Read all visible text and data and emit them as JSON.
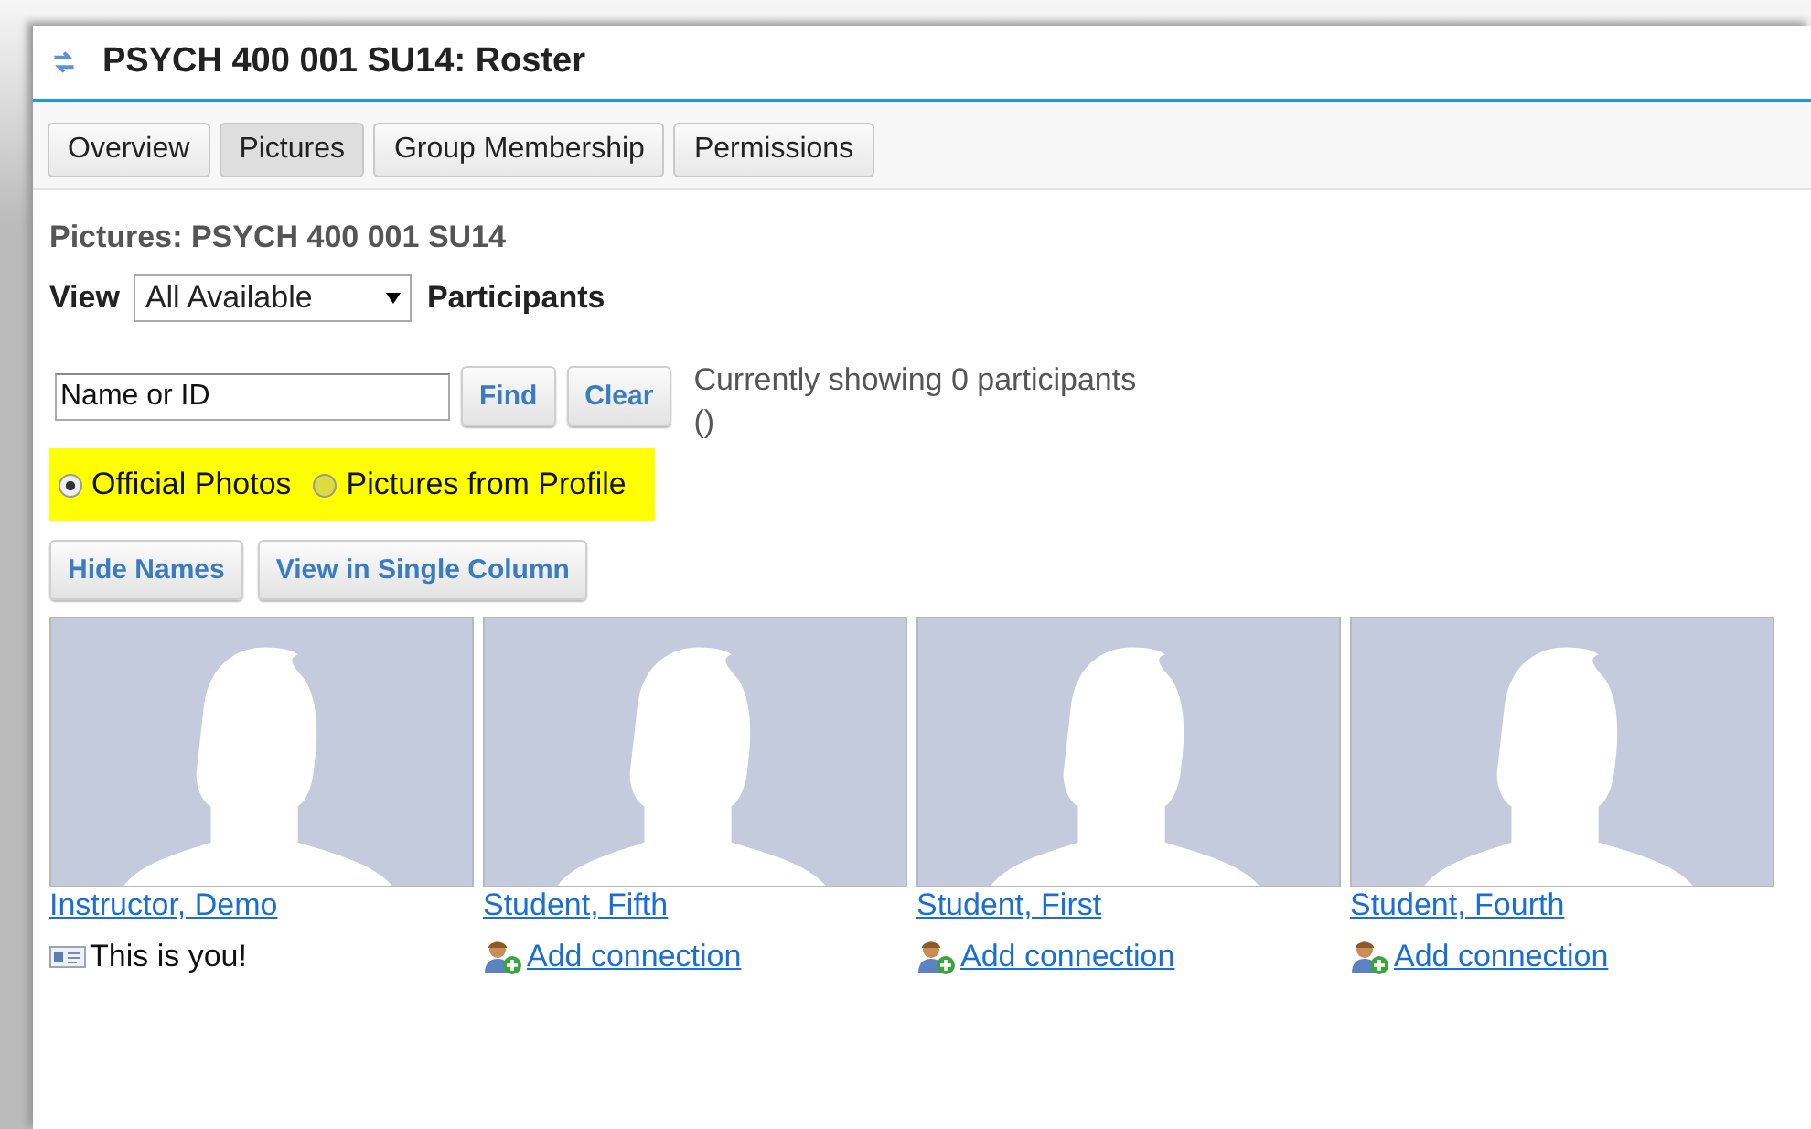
{
  "title": "PSYCH 400 001 SU14: Roster",
  "tabs": [
    {
      "label": "Overview",
      "selected": false
    },
    {
      "label": "Pictures",
      "selected": true
    },
    {
      "label": "Group Membership",
      "selected": false
    },
    {
      "label": "Permissions",
      "selected": false
    }
  ],
  "heading": "Pictures: PSYCH 400 001 SU14",
  "view": {
    "label": "View",
    "value": "All Available",
    "suffix": "Participants"
  },
  "search": {
    "value": "Name or ID",
    "buttons": [
      "Find",
      "Clear"
    ],
    "status": "Currently showing 0 participants",
    "status_extra": "()"
  },
  "photo_source": [
    {
      "label": "Official Photos",
      "selected": true
    },
    {
      "label": "Pictures from Profile",
      "selected": false
    }
  ],
  "actions": [
    "Hide Names",
    "View in Single Column"
  ],
  "participants": [
    {
      "name": "Instructor, Demo",
      "kind": "self",
      "note": "This is you!"
    },
    {
      "name": "Student, Fifth",
      "kind": "other",
      "note": "Add connection"
    },
    {
      "name": "Student, First",
      "kind": "other",
      "note": "Add connection"
    },
    {
      "name": "Student, Fourth",
      "kind": "other",
      "note": "Add connection"
    }
  ]
}
